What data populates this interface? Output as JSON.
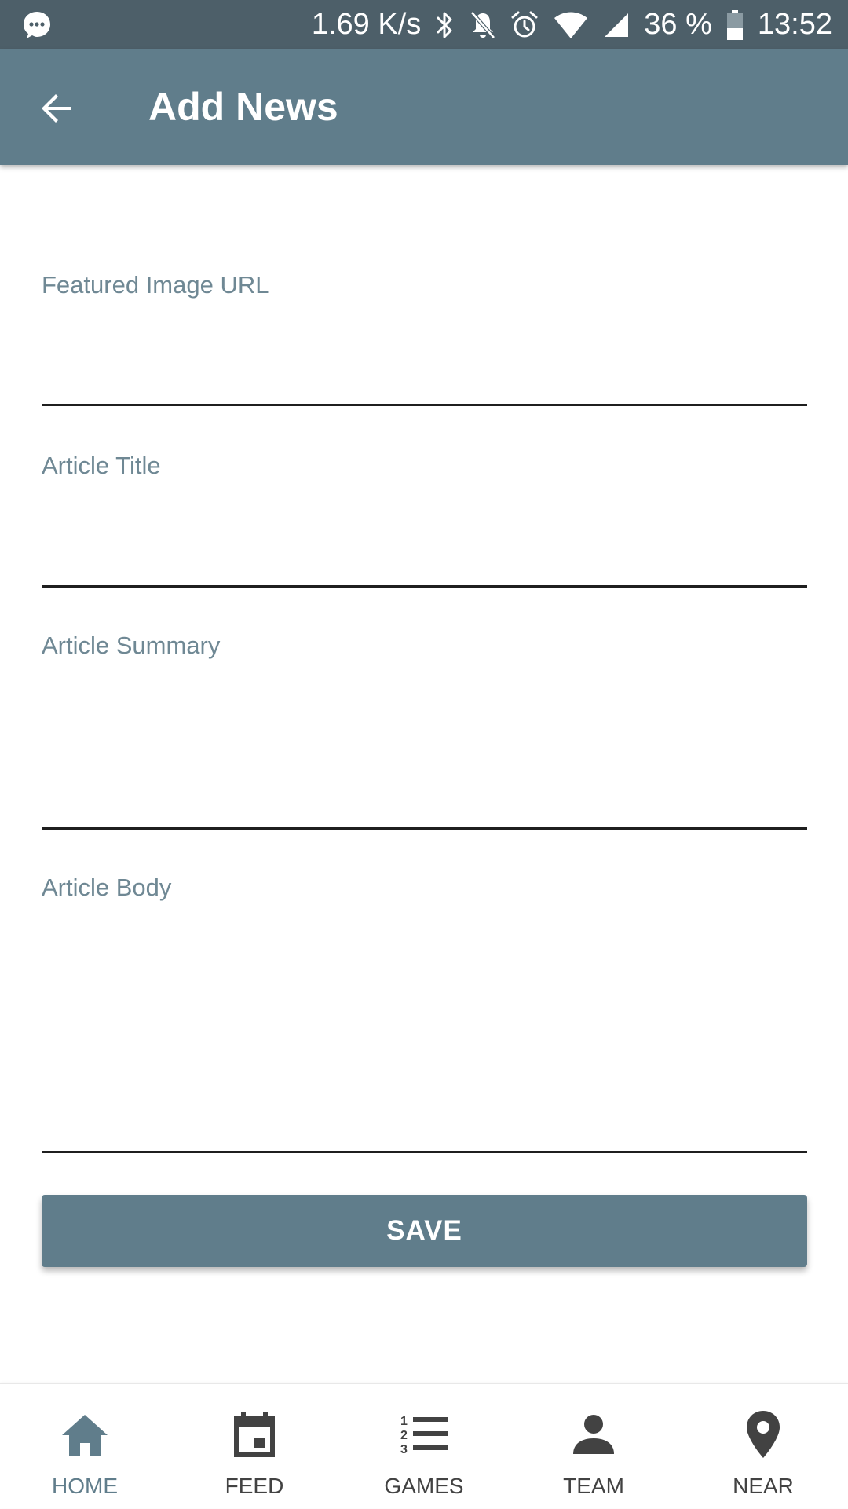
{
  "status_bar": {
    "speed": "1.69 K/s",
    "battery": "36 %",
    "time": "13:52",
    "icons": [
      "chat-bubble-icon",
      "bluetooth-icon",
      "notifications-off-icon",
      "alarm-icon",
      "wifi-icon",
      "cell-signal-icon",
      "battery-icon"
    ]
  },
  "app_bar": {
    "title": "Add News",
    "back_icon": "arrow-back-icon",
    "background": "#607d8b"
  },
  "form": {
    "image_url": {
      "label": "Featured Image URL",
      "value": ""
    },
    "title": {
      "label": "Article Title",
      "value": ""
    },
    "summary": {
      "label": "Article Summary",
      "value": ""
    },
    "body": {
      "label": "Article Body",
      "value": ""
    },
    "save_label": "SAVE"
  },
  "bottom_nav": {
    "active": "HOME",
    "active_color": "#607d8b",
    "items": [
      {
        "label": "HOME",
        "icon": "home-icon"
      },
      {
        "label": "FEED",
        "icon": "calendar-icon"
      },
      {
        "label": "GAMES",
        "icon": "numbered-list-icon"
      },
      {
        "label": "TEAM",
        "icon": "person-icon"
      },
      {
        "label": "NEAR",
        "icon": "location-pin-icon"
      }
    ]
  }
}
